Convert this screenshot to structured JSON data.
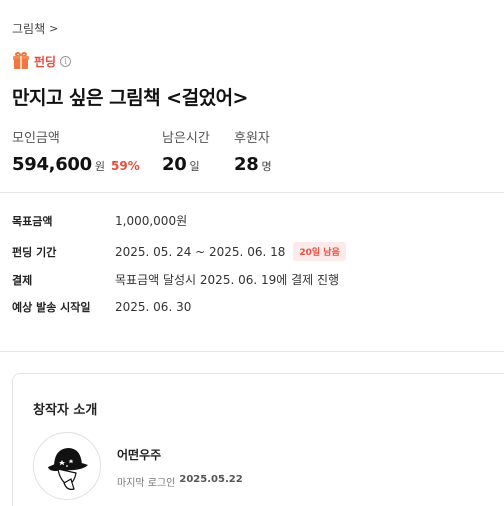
{
  "breadcrumb": {
    "category": "그림책",
    "chevron": ">"
  },
  "funding": {
    "label": "펀딩",
    "info": "i"
  },
  "project": {
    "title": "만지고 싶은 그림책 <걸었어>"
  },
  "stats": {
    "raised": {
      "label": "모인금액",
      "value": "594,600",
      "unit": "원",
      "percent": "59%"
    },
    "time_left": {
      "label": "남은시간",
      "value": "20",
      "unit": "일"
    },
    "backers": {
      "label": "후원자",
      "value": "28",
      "unit": "명"
    }
  },
  "details": {
    "goal": {
      "label": "목표금액",
      "value": "1,000,000원"
    },
    "period": {
      "label": "펀딩 기간",
      "value": "2025. 05. 24 ~ 2025. 06. 18",
      "badge": "20일 남음"
    },
    "payment": {
      "label": "결제",
      "value": "목표금액 달성시 2025. 06. 19에 결제 진행"
    },
    "shipping": {
      "label": "예상 발송 시작일",
      "value": "2025. 06. 30"
    }
  },
  "creator": {
    "heading": "창작자 소개",
    "name": "어떤우주",
    "last_login_label": "마지막 로그인",
    "last_login_date": "2025.05.22"
  },
  "colors": {
    "accent": "#e94e3c",
    "gift": "#f1773e"
  },
  "icons": [
    "chevron-right-icon",
    "gift-icon",
    "info-icon",
    "creator-avatar-image"
  ]
}
